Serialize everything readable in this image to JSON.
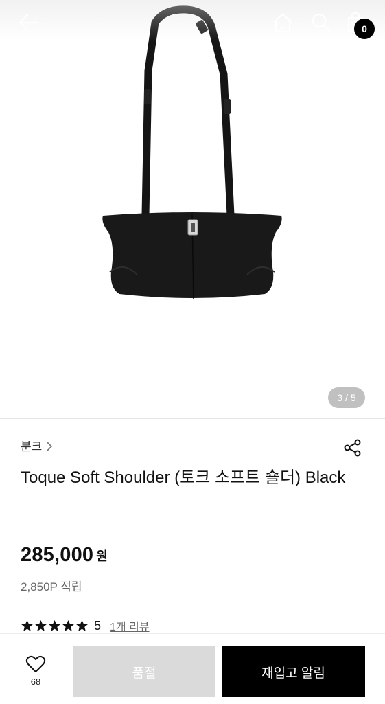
{
  "header": {
    "back_icon": "arrow-left-icon",
    "home_icon": "home-icon",
    "search_icon": "search-icon",
    "cart_icon": "shopping-bag-icon",
    "cart_count": "0"
  },
  "gallery": {
    "counter": "3 / 5",
    "current": 3,
    "total": 5
  },
  "product": {
    "brand": "분크",
    "title": "Toque Soft Shoulder (토크 소프트 숄더) Black",
    "price": "285,000",
    "price_unit": "원",
    "points": "2,850P 적립",
    "rating": "5",
    "rating_stars": 5,
    "review_link": "1개 리뷰"
  },
  "actions": {
    "wish_count": "68",
    "soldout_label": "품절",
    "restock_label": "재입고 알림"
  },
  "colors": {
    "accent": "#000000",
    "disabled": "#dadada",
    "text_secondary": "#666666"
  }
}
